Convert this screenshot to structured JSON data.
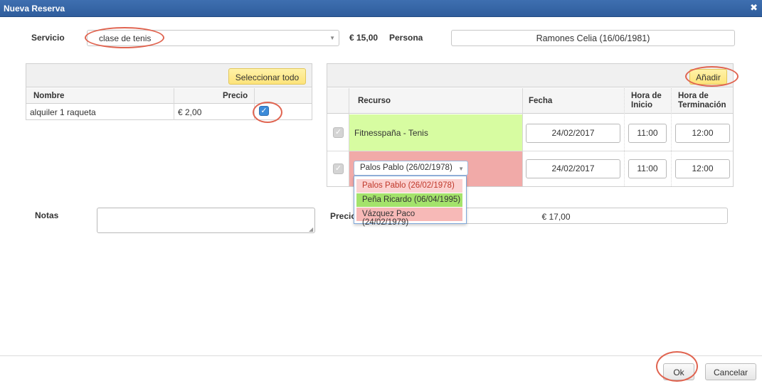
{
  "window": {
    "title": "Nueva Reserva",
    "close_icon": "✖"
  },
  "form": {
    "servicio_label": "Servicio",
    "servicio_value": "clase de tenis",
    "servicio_price": "€ 15,00",
    "persona_label": "Persona",
    "persona_value": "Ramones Celia (16/06/1981)",
    "notas_label": "Notas",
    "notas_value": "",
    "precio_label": "Precio",
    "precio_value": "€ 17,00"
  },
  "extras": {
    "select_all_label": "Seleccionar todo",
    "columns": {
      "nombre": "Nombre",
      "precio": "Precio"
    },
    "rows": [
      {
        "nombre": "alquiler 1 raqueta",
        "precio": "€ 2,00",
        "checked": true
      }
    ]
  },
  "resources": {
    "add_label": "Añadir",
    "columns": {
      "recurso": "Recurso",
      "fecha": "Fecha",
      "inicio_l1": "Hora de",
      "inicio_l2": "Inicio",
      "fin_l1": "Hora de",
      "fin_l2": "Terminación"
    },
    "rows": [
      {
        "recurso": "Fitnesspaña - Tenis",
        "fecha": "24/02/2017",
        "inicio": "11:00",
        "fin": "12:00",
        "bg": "#d7fca1"
      },
      {
        "recurso": "Palos Pablo (26/02/1978)",
        "fecha": "24/02/2017",
        "inicio": "11:00",
        "fin": "12:00",
        "bg": "#f1aaa8"
      }
    ],
    "dropdown_options": [
      {
        "label": "Palos Pablo (26/02/1978)",
        "bg": "#fbd1d0",
        "color": "#c0392b"
      },
      {
        "label": "Peña Ricardo (06/04/1995)",
        "bg": "#a4e36b",
        "color": "#333333"
      },
      {
        "label": "Vázquez Paco (24/02/1979)",
        "bg": "#f7b9b7",
        "color": "#333333"
      }
    ]
  },
  "footer": {
    "ok_label": "Ok",
    "cancel_label": "Cancelar"
  },
  "colors": {
    "title_bar": "#2f5d9c",
    "highlight_circle": "#e06450",
    "button_yellow": "#fde37a",
    "checkbox_blue": "#3c8bd9"
  }
}
